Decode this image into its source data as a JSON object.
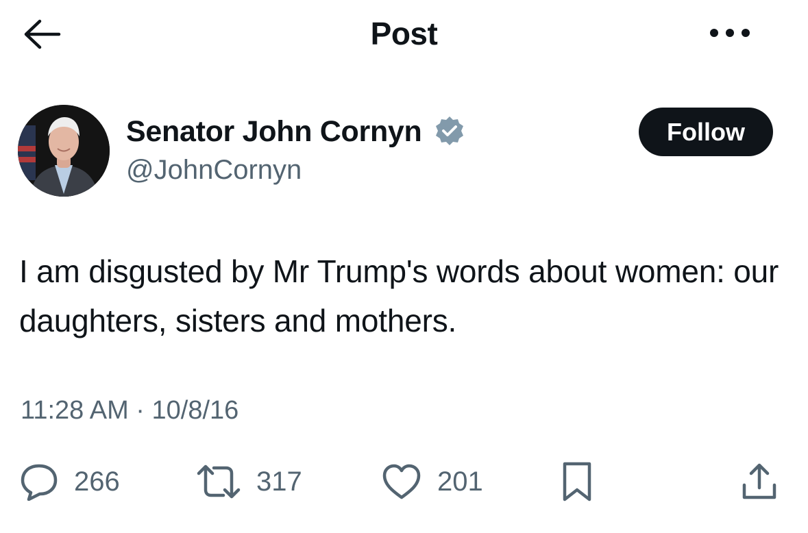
{
  "header": {
    "title": "Post",
    "back_icon": "arrow-left-icon",
    "more_icon": "more-horizontal-icon"
  },
  "author": {
    "display_name": "Senator John Cornyn",
    "handle": "@JohnCornyn",
    "verified_icon": "verified-badge-icon",
    "verified_color": "#829aab",
    "follow_label": "Follow"
  },
  "post": {
    "text": "I am disgusted by Mr Trump's words about women: our daughters, sisters and mothers.",
    "timestamp": "11:28 AM · 10/8/16"
  },
  "actions": {
    "replies": "266",
    "reposts": "317",
    "likes": "201"
  },
  "colors": {
    "text_primary": "#0f1419",
    "text_secondary": "#536471",
    "follow_bg": "#0f1419"
  }
}
